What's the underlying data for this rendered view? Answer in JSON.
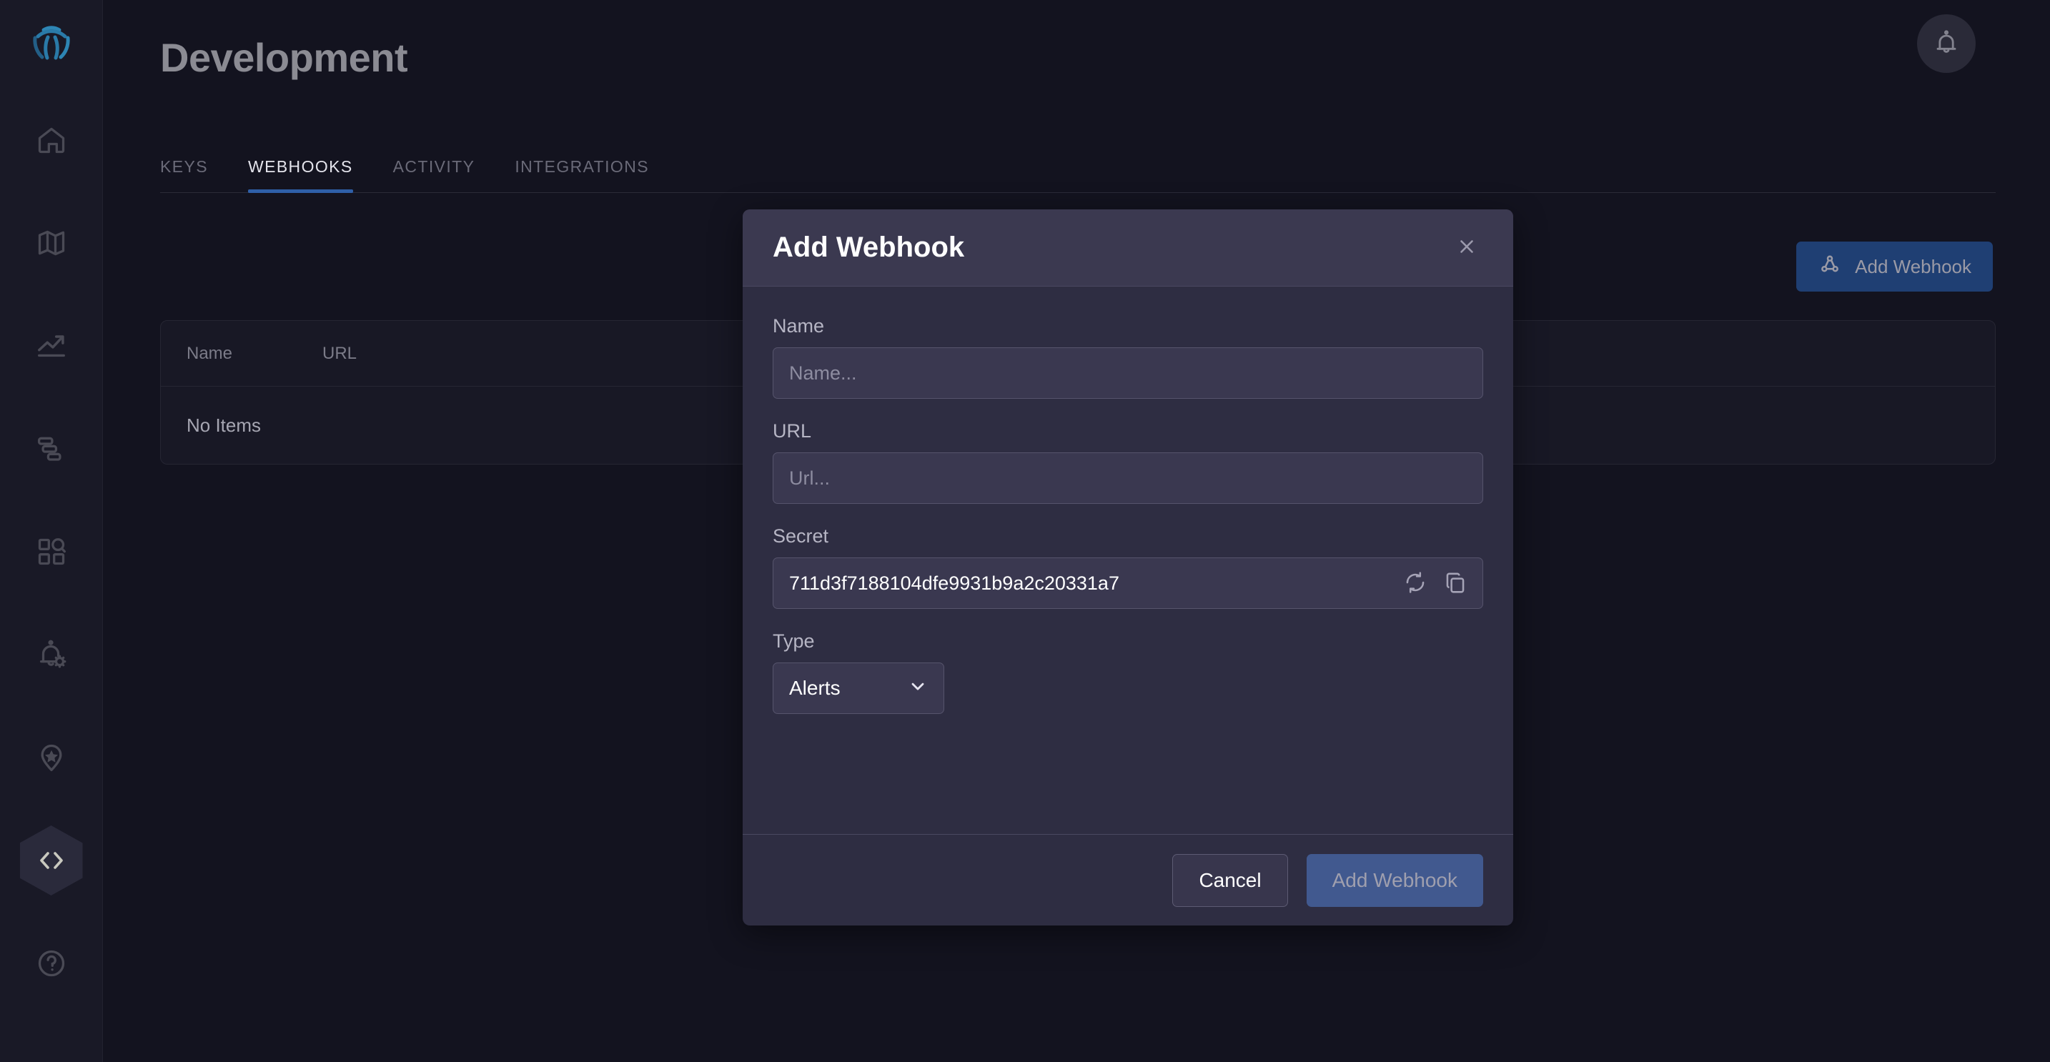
{
  "app": {
    "brand_icon": "nightingale-logo-icon"
  },
  "sidebar": {
    "items": [
      {
        "name": "home",
        "icon": "home-icon",
        "active": false
      },
      {
        "name": "map",
        "icon": "map-icon",
        "active": false
      },
      {
        "name": "analytics",
        "icon": "trending-up-icon",
        "active": false
      },
      {
        "name": "layers",
        "icon": "stacked-bars-icon",
        "active": false
      },
      {
        "name": "explore",
        "icon": "grid-search-icon",
        "active": false
      },
      {
        "name": "alert-settings",
        "icon": "bell-gear-icon",
        "active": false
      },
      {
        "name": "places",
        "icon": "map-pin-star-icon",
        "active": false
      },
      {
        "name": "developer",
        "icon": "code-brackets-icon",
        "active": true
      },
      {
        "name": "help",
        "icon": "question-circle-icon",
        "active": false
      }
    ]
  },
  "header": {
    "title": "Development",
    "notifications_icon": "bell-icon"
  },
  "tabs": [
    {
      "label": "KEYS",
      "active": false
    },
    {
      "label": "WEBHOOKS",
      "active": true
    },
    {
      "label": "ACTIVITY",
      "active": false
    },
    {
      "label": "INTEGRATIONS",
      "active": false
    }
  ],
  "toolbar": {
    "add_webhook_label": "Add Webhook",
    "add_webhook_icon": "webhook-icon"
  },
  "table": {
    "columns": [
      "Name",
      "URL"
    ],
    "empty_text": "No Items",
    "rows": []
  },
  "modal": {
    "title": "Add Webhook",
    "close_icon": "close-icon",
    "fields": {
      "name": {
        "label": "Name",
        "placeholder": "Name...",
        "value": ""
      },
      "url": {
        "label": "URL",
        "placeholder": "Url...",
        "value": ""
      },
      "secret": {
        "label": "Secret",
        "value": "711d3f7188104dfe9931b9a2c20331a7",
        "regenerate_icon": "refresh-icon",
        "copy_icon": "copy-icon"
      },
      "type": {
        "label": "Type",
        "value": "Alerts",
        "options": [
          "Alerts"
        ],
        "chevron_icon": "chevron-down-icon"
      }
    },
    "footer": {
      "cancel_label": "Cancel",
      "submit_label": "Add Webhook",
      "submit_disabled": true
    }
  },
  "colors": {
    "page_bg": "#13131f",
    "sidebar_bg": "#191926",
    "modal_bg": "#2e2d42",
    "modal_header_bg": "#3b3950",
    "accent_blue": "#2f5fa8",
    "button_blue": "#1f3f73",
    "submit_blue": "#41598f",
    "brand_teal": "#2b7ba8"
  }
}
